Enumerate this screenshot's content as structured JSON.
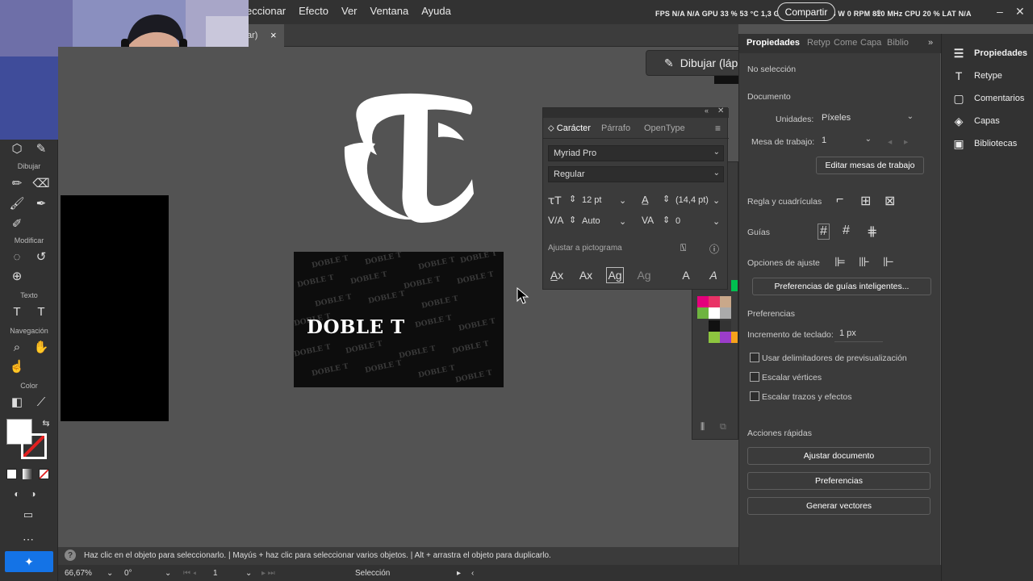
{
  "menu": {
    "items": [
      "eccionar",
      "Efecto",
      "Ver",
      "Ventana",
      "Ayuda"
    ]
  },
  "overlay": {
    "stats": "FPS  N/A  N/A    GPU 33 %  53 °C  1,3 GHz  1890 MHz  33 W  0 RPM  810 MHz    CPU 20 %    LAT  N/A"
  },
  "share": {
    "label": "Compartir"
  },
  "tab": {
    "label": "ar)",
    "close": "×"
  },
  "toolbar": {
    "sections": [
      "Dibujar",
      "Modificar",
      "Texto",
      "Navegación",
      "Color"
    ]
  },
  "draw_mode": {
    "label": "Dibujar (láp"
  },
  "artwork": {
    "card_text": "DOBLE T",
    "pattern_text": "DOBLE T"
  },
  "character_panel": {
    "tabs": [
      "Carácter",
      "Párrafo",
      "OpenType"
    ],
    "font_family": "Myriad Pro",
    "font_style": "Regular",
    "font_size": "12 pt",
    "leading": "(14,4 pt)",
    "kerning": "Auto",
    "tracking": "0",
    "snap_label": "Ajustar a pictograma"
  },
  "properties": {
    "tabs": [
      "Propiedades",
      "Retyp",
      "Come",
      "Capa",
      "Biblio"
    ],
    "no_selection": "No selección",
    "document": "Documento",
    "units_label": "Unidades:",
    "units_value": "Píxeles",
    "artboard_label": "Mesa de trabajo:",
    "artboard_value": "1",
    "edit_artboards": "Editar mesas de trabajo",
    "rulers": "Regla y cuadrículas",
    "guides": "Guías",
    "snap_options": "Opciones de ajuste",
    "smart_guides": "Preferencias de guías inteligentes...",
    "preferences": "Preferencias",
    "keyboard_inc_label": "Incremento de teclado:",
    "keyboard_inc_value": "1 px",
    "check_preview": "Usar delimitadores de previsualización",
    "check_corners": "Escalar vértices",
    "check_strokes": "Escalar trazos y efectos",
    "quick_actions": "Acciones rápidas",
    "btn_fit": "Ajustar documento",
    "btn_prefs": "Preferencias",
    "btn_vectors": "Generar vectores"
  },
  "dock": {
    "items": [
      "Propiedades",
      "Retype",
      "Comentarios",
      "Capas",
      "Bibliotecas"
    ]
  },
  "status": {
    "hint": "Haz clic en el objeto para seleccionarlo.  |  Mayús + haz clic para seleccionar varios objetos.  |  Alt + arrastra el objeto para duplicarlo."
  },
  "bottom": {
    "zoom": "66,67%",
    "rotation": "0°",
    "artboard": "1",
    "tool": "Selección"
  },
  "colors": {
    "accent": "#1473e6",
    "panel": "#3b3b3b",
    "canvas": "#535353"
  }
}
